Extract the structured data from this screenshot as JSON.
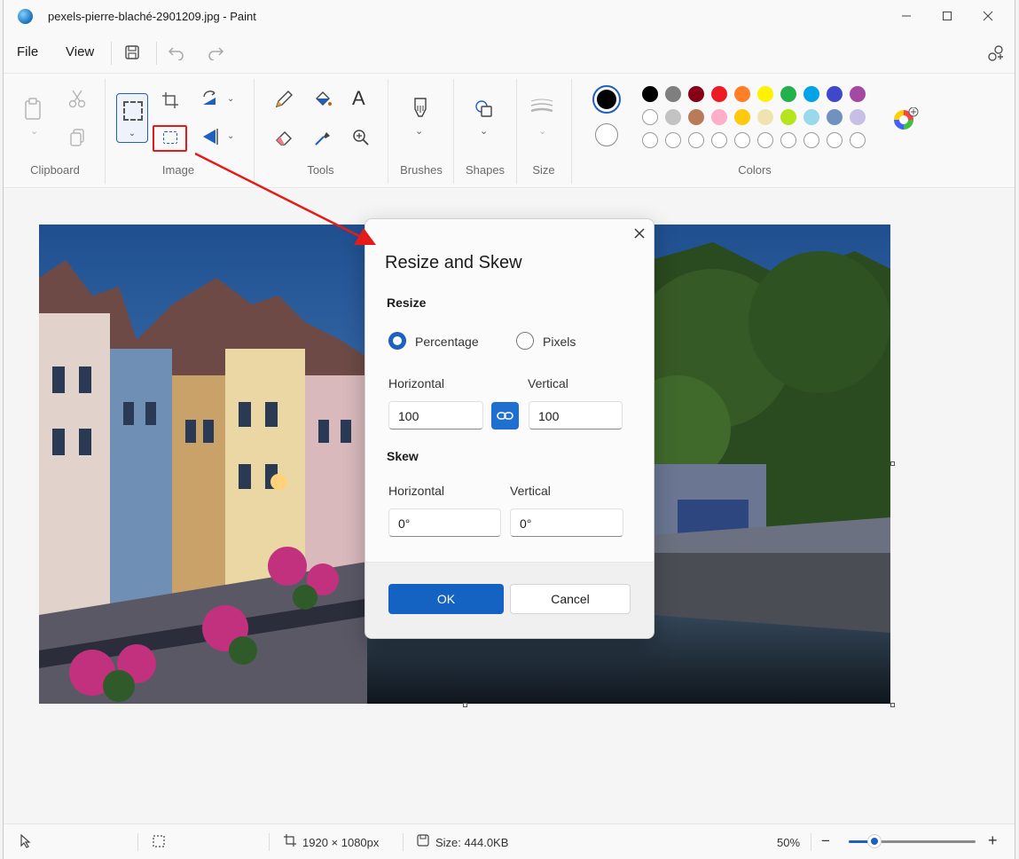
{
  "window": {
    "title": "pexels-pierre-blaché-2901209.jpg - Paint",
    "minimize_icon": "minimize-icon",
    "maximize_icon": "maximize-icon",
    "close_icon": "close-icon"
  },
  "menu": {
    "file": "File",
    "view": "View",
    "icons": [
      "save-icon",
      "undo-icon",
      "redo-icon",
      "share-icon"
    ]
  },
  "ribbon": {
    "groups": {
      "clipboard": "Clipboard",
      "image": "Image",
      "tools": "Tools",
      "brushes": "Brushes",
      "shapes": "Shapes",
      "size": "Size",
      "colors": "Colors"
    },
    "text_tool_glyph": "A",
    "palette_row1": [
      "#000000",
      "#7f7f7f",
      "#880015",
      "#ed1c24",
      "#ff7f27",
      "#fff200",
      "#22b14c",
      "#00a2e8",
      "#3f48cc",
      "#a349a4"
    ],
    "palette_row2": [
      "#ffffff",
      "#c3c3c3",
      "#b97a57",
      "#ffaec9",
      "#ffc90e",
      "#efe4b0",
      "#b5e61d",
      "#99d9ea",
      "#7092be",
      "#c8bfe7"
    ],
    "palette_row3_count": 10,
    "primary_color": "#000000",
    "secondary_color": "#ffffff"
  },
  "dialog": {
    "title": "Resize and Skew",
    "resize_heading": "Resize",
    "option_percentage": "Percentage",
    "option_pixels": "Pixels",
    "selected_option": "Percentage",
    "horizontal_label": "Horizontal",
    "vertical_label": "Vertical",
    "resize_horizontal_value": "100",
    "resize_vertical_value": "100",
    "skew_heading": "Skew",
    "skew_horizontal_label": "Horizontal",
    "skew_vertical_label": "Vertical",
    "skew_horizontal_value": "0°",
    "skew_vertical_value": "0°",
    "ok_label": "OK",
    "cancel_label": "Cancel"
  },
  "status": {
    "dimensions": "1920 × 1080px",
    "size": "Size: 444.0KB",
    "zoom": "50%",
    "zoom_minus": "−",
    "zoom_plus": "+",
    "zoom_level": 0.2
  }
}
